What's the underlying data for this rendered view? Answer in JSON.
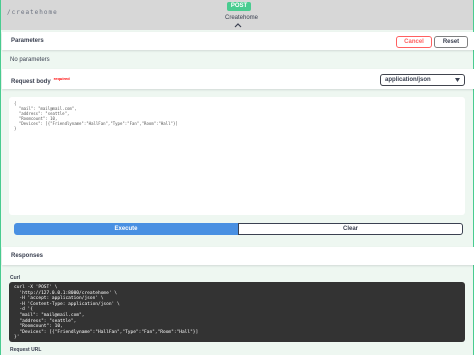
{
  "operation": {
    "method": "POST",
    "path": "/createhome",
    "description": "Createhome"
  },
  "parameters": {
    "title": "Parameters",
    "cancel_label": "Cancel",
    "reset_label": "Reset",
    "empty_text": "No parameters"
  },
  "request_body": {
    "title": "Request body",
    "required_label": "required",
    "content_type": "application/json",
    "example": "{\n  \"mail\": \"mail@mail.com\",\n  \"address\": \"seattle\",\n  \"Roomcount\": 10,\n  \"Devices\": [{\"Friendlyname\":\"HallFan\",\"Type\":\"Fan\",\"Room\":\"Hall\"}]\n}"
  },
  "actions": {
    "execute_label": "Execute",
    "clear_label": "Clear"
  },
  "responses": {
    "title": "Responses",
    "curl_label": "Curl",
    "curl_command": "curl -X 'POST' \\\n  'http://127.0.0.1:8000/createhome' \\\n  -H 'accept: application/json' \\\n  -H 'Content-Type: application/json' \\\n  -d '{\n  \"mail\": \"mail@mail.com\",\n  \"address\": \"seattle\",\n  \"Roomcount\": 10,\n  \"Devices\": [{\"Friendlyname\":\"HallFan\",\"Type\":\"Fan\",\"Room\":\"Hall\"}]\n}'",
    "request_url_label": "Request URL"
  },
  "colors": {
    "post_green": "#49cc90",
    "execute_blue": "#4990e2",
    "cancel_red": "#ff6060",
    "code_bg": "#333333"
  }
}
